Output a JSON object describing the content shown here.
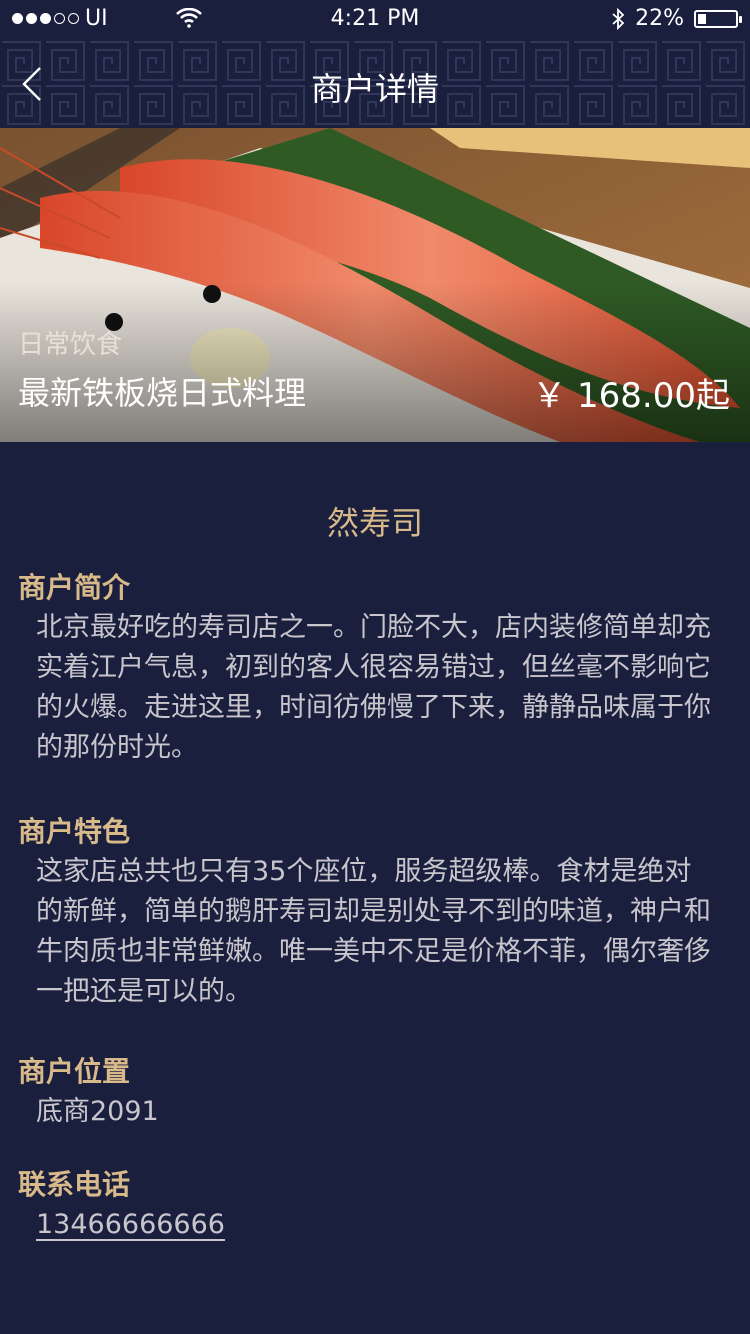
{
  "status_bar": {
    "carrier": "UI",
    "time": "4:21 PM",
    "battery_text": "22%",
    "battery_level": 0.22
  },
  "nav": {
    "title": "商户详情",
    "back_icon": "chevron-left-icon"
  },
  "hero": {
    "category": "日常饮食",
    "title": "最新铁板烧日式料理",
    "price": "￥ 168.00起"
  },
  "shop": {
    "name": "然寿司"
  },
  "sections": {
    "intro": {
      "title": "商户简介",
      "body": "北京最好吃的寿司店之一。门脸不大，店内装修简单却充实着江户气息，初到的客人很容易错过，但丝毫不影响它的火爆。走进这里，时间彷佛慢了下来，静静品味属于你的那份时光。"
    },
    "features": {
      "title": "商户特色",
      "body": "这家店总共也只有35个座位，服务超级棒。食材是绝对的新鲜，简单的鹅肝寿司却是别处寻不到的味道，神户和牛肉质也非常鲜嫩。唯一美中不足是价格不菲，偶尔奢侈一把还是可以的。"
    },
    "location": {
      "title": "商户位置",
      "body": "底商2091"
    },
    "phone": {
      "title": "联系电话",
      "body": "13466666666"
    }
  },
  "colors": {
    "background": "#1b1f3e",
    "accent": "#d8b98a",
    "body_text": "#c8c6cc"
  }
}
